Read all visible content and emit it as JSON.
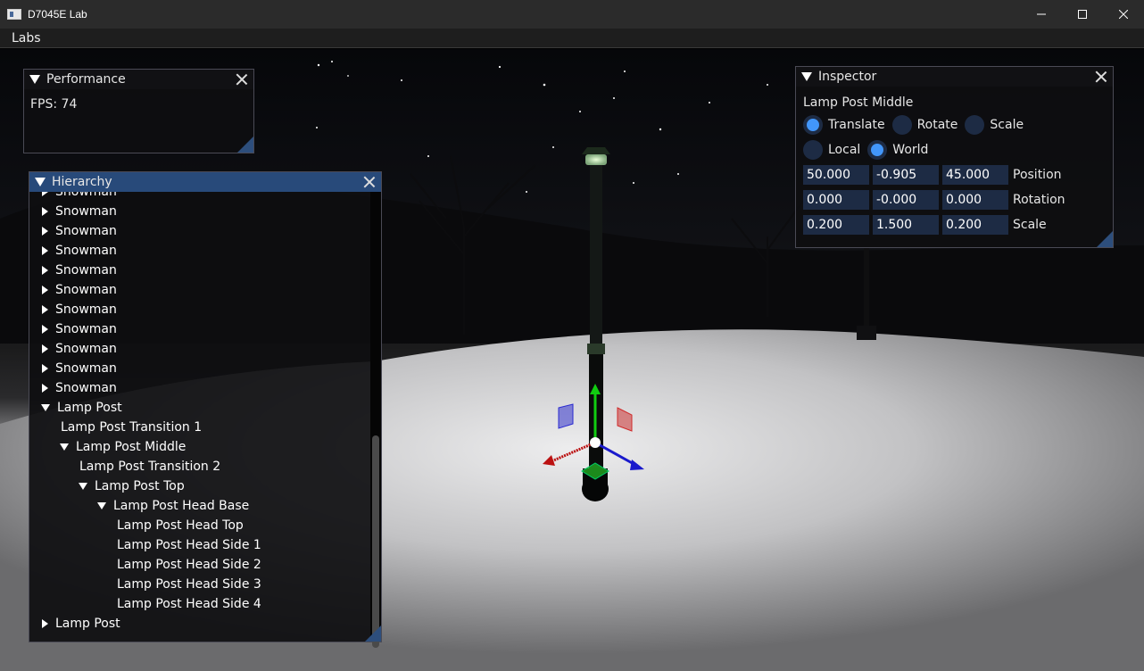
{
  "window": {
    "title": "D7045E Lab"
  },
  "menubar": {
    "items": [
      "Labs"
    ]
  },
  "performance": {
    "title": "Performance",
    "fps_text": "FPS: 74"
  },
  "hierarchy": {
    "title": "Hierarchy",
    "rows": [
      {
        "label": "Snowman",
        "depth": 0,
        "expanded": false,
        "leaf": false
      },
      {
        "label": "Snowman",
        "depth": 0,
        "expanded": false,
        "leaf": false
      },
      {
        "label": "Snowman",
        "depth": 0,
        "expanded": false,
        "leaf": false
      },
      {
        "label": "Snowman",
        "depth": 0,
        "expanded": false,
        "leaf": false
      },
      {
        "label": "Snowman",
        "depth": 0,
        "expanded": false,
        "leaf": false
      },
      {
        "label": "Snowman",
        "depth": 0,
        "expanded": false,
        "leaf": false
      },
      {
        "label": "Snowman",
        "depth": 0,
        "expanded": false,
        "leaf": false
      },
      {
        "label": "Snowman",
        "depth": 0,
        "expanded": false,
        "leaf": false
      },
      {
        "label": "Snowman",
        "depth": 0,
        "expanded": false,
        "leaf": false
      },
      {
        "label": "Snowman",
        "depth": 0,
        "expanded": false,
        "leaf": false
      },
      {
        "label": "Snowman",
        "depth": 0,
        "expanded": false,
        "leaf": false
      },
      {
        "label": "Lamp Post",
        "depth": 0,
        "expanded": true,
        "leaf": false
      },
      {
        "label": "Lamp Post Transition 1",
        "depth": 1,
        "expanded": false,
        "leaf": true
      },
      {
        "label": "Lamp Post Middle",
        "depth": 1,
        "expanded": true,
        "leaf": false
      },
      {
        "label": "Lamp Post Transition 2",
        "depth": 2,
        "expanded": false,
        "leaf": true
      },
      {
        "label": "Lamp Post Top",
        "depth": 2,
        "expanded": true,
        "leaf": false
      },
      {
        "label": "Lamp Post Head Base",
        "depth": 3,
        "expanded": true,
        "leaf": false
      },
      {
        "label": "Lamp Post Head Top",
        "depth": 4,
        "expanded": false,
        "leaf": true
      },
      {
        "label": "Lamp Post Head Side 1",
        "depth": 4,
        "expanded": false,
        "leaf": true
      },
      {
        "label": "Lamp Post Head Side 2",
        "depth": 4,
        "expanded": false,
        "leaf": true
      },
      {
        "label": "Lamp Post Head Side 3",
        "depth": 4,
        "expanded": false,
        "leaf": true
      },
      {
        "label": "Lamp Post Head Side 4",
        "depth": 4,
        "expanded": false,
        "leaf": true
      },
      {
        "label": "Lamp Post",
        "depth": 0,
        "expanded": false,
        "leaf": false
      }
    ]
  },
  "inspector": {
    "title": "Inspector",
    "object_name": "Lamp Post Middle",
    "mode_options": [
      "Translate",
      "Rotate",
      "Scale"
    ],
    "mode_selected": "Translate",
    "space_options": [
      "Local",
      "World"
    ],
    "space_selected": "World",
    "position": {
      "label": "Position",
      "x": "50.000",
      "y": "-0.905",
      "z": "45.000"
    },
    "rotation": {
      "label": "Rotation",
      "x": "0.000",
      "y": "-0.000",
      "z": "0.000"
    },
    "scale": {
      "label": "Scale",
      "x": "0.200",
      "y": "1.500",
      "z": "0.200"
    }
  },
  "colors": {
    "accent": "#4296fa",
    "title_active": "#284a7a",
    "frame_bg": "#1d2b44",
    "gizmo_x": "#cc1111",
    "gizmo_y": "#11cc11",
    "gizmo_z": "#1111cc"
  }
}
